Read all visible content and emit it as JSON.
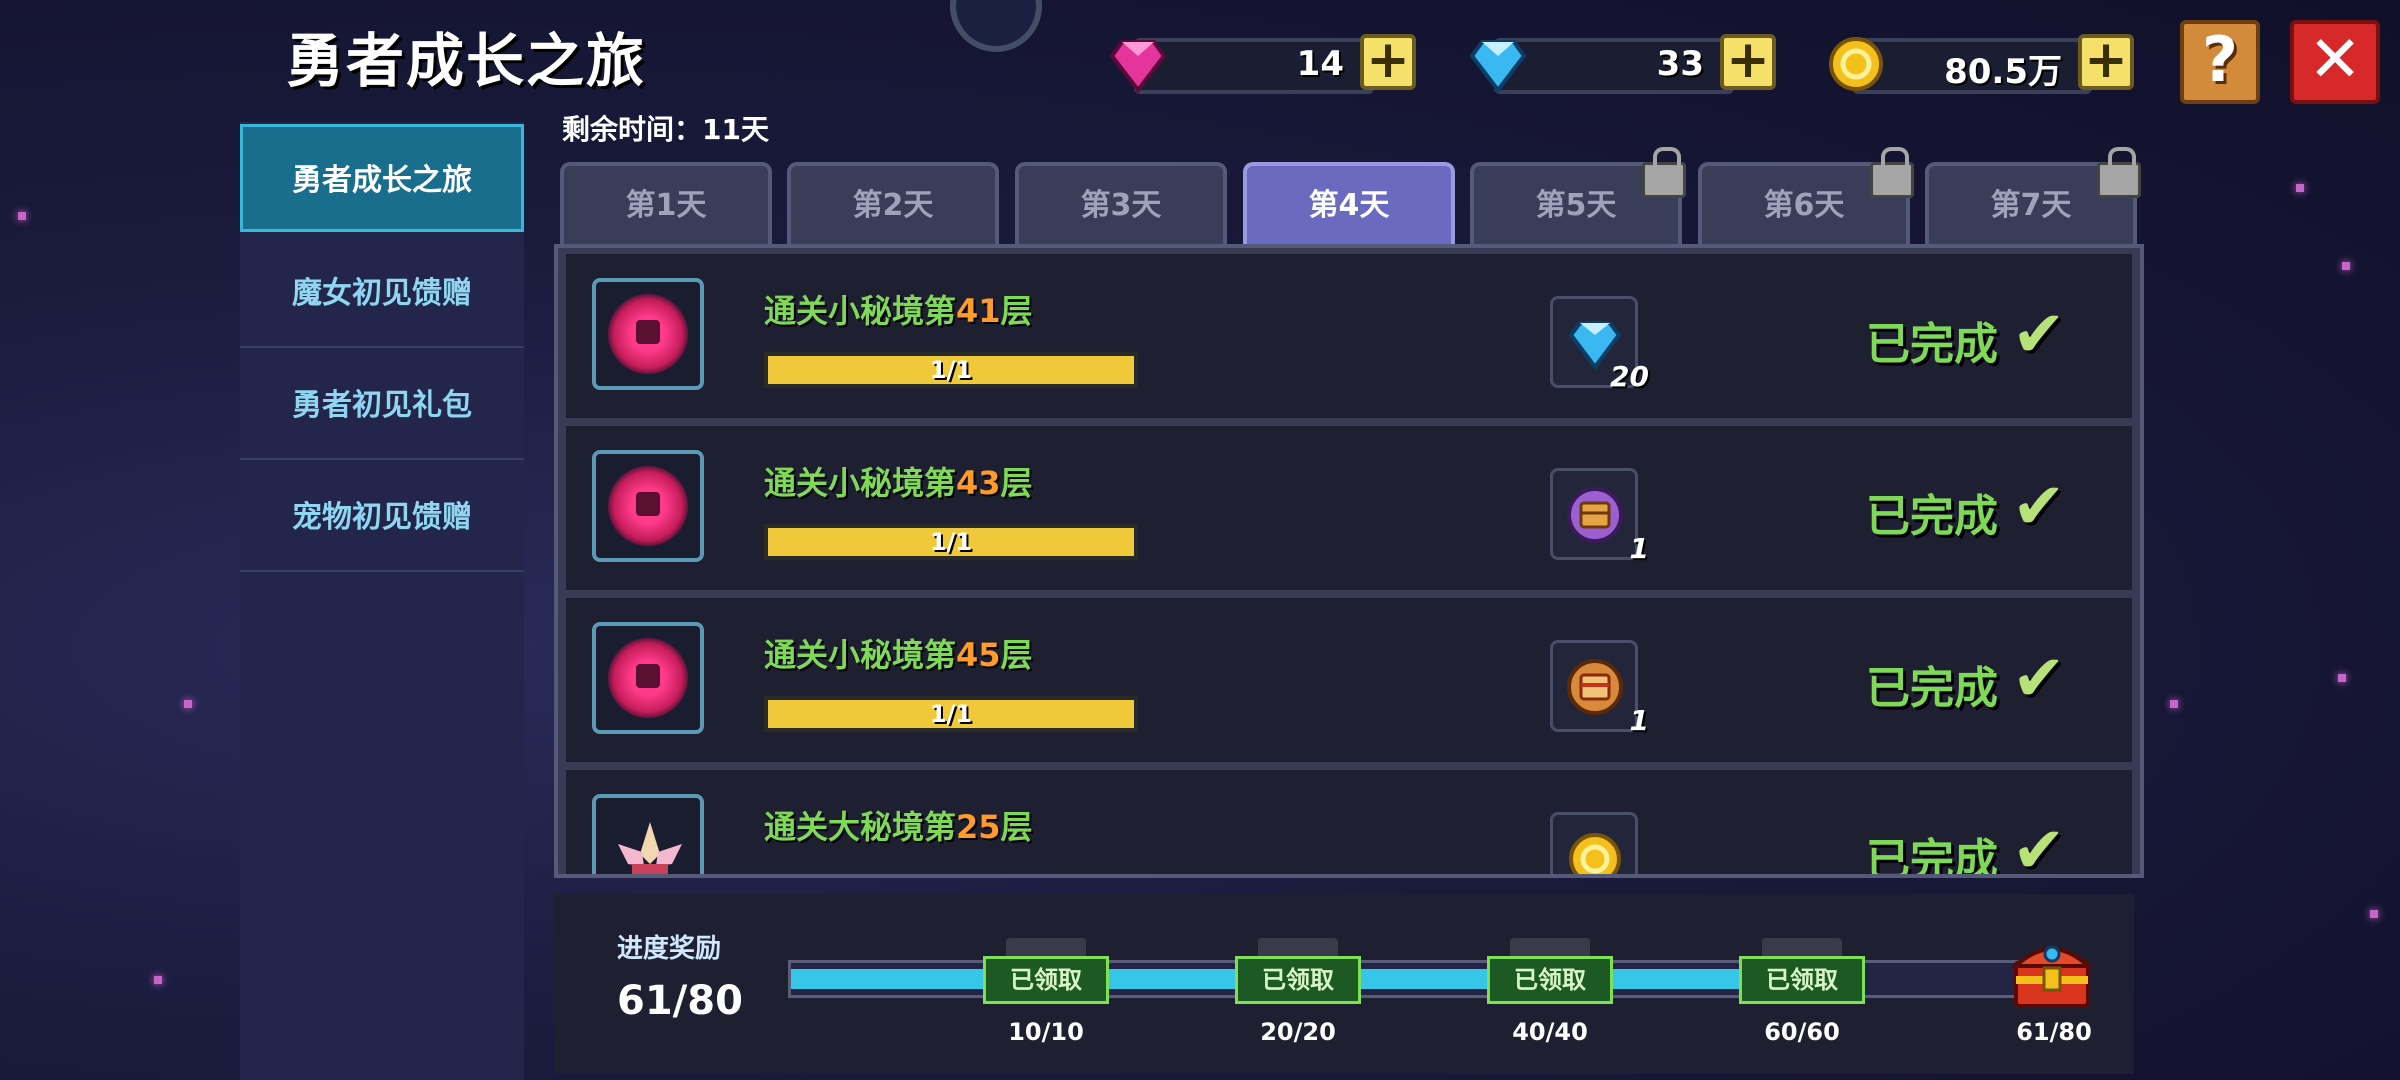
{
  "header": {
    "title": "勇者成长之旅"
  },
  "currencies": [
    {
      "icon": "pink-gem-icon",
      "value": "14",
      "color": "#e5359c"
    },
    {
      "icon": "blue-diamond-icon",
      "value": "33",
      "color": "#39b8f2"
    },
    {
      "icon": "gold-coin-icon",
      "value": "80.5万",
      "color": "#f4c01b"
    }
  ],
  "buttons": {
    "help": "?",
    "close": "✕",
    "plus": "+"
  },
  "sidebar": {
    "items": [
      {
        "label": "勇者成长之旅",
        "active": true
      },
      {
        "label": "魔女初见馈赠"
      },
      {
        "label": "勇者初见礼包"
      },
      {
        "label": "宠物初见馈赠"
      }
    ]
  },
  "remaining_time": "剩余时间：11天",
  "tabs": [
    {
      "label": "第1天"
    },
    {
      "label": "第2天"
    },
    {
      "label": "第3天"
    },
    {
      "label": "第4天",
      "active": true
    },
    {
      "label": "第5天",
      "locked": true
    },
    {
      "label": "第6天",
      "locked": true
    },
    {
      "label": "第7天",
      "locked": true
    }
  ],
  "tasks": [
    {
      "title_prefix": "通关小秘境第",
      "num": "41",
      "title_suffix": "层",
      "progress": "1/1",
      "reward_icon": "blue-diamond-icon",
      "reward_count": "20",
      "status": "已完成"
    },
    {
      "title_prefix": "通关小秘境第",
      "num": "43",
      "title_suffix": "层",
      "progress": "1/1",
      "reward_icon": "purple-chest-icon",
      "reward_count": "1",
      "status": "已完成"
    },
    {
      "title_prefix": "通关小秘境第",
      "num": "45",
      "title_suffix": "层",
      "progress": "1/1",
      "reward_icon": "orange-chest-icon",
      "reward_count": "1",
      "status": "已完成"
    },
    {
      "title_prefix": "通关大秘境第",
      "num": "25",
      "title_suffix": "层",
      "progress": "",
      "reward_icon": "gold-coin-icon",
      "reward_count": "",
      "status": "已完成"
    }
  ],
  "progress_reward": {
    "label": "进度奖励",
    "value": "61/80",
    "fraction": 0.7625,
    "milestones": [
      {
        "button": "已领取",
        "label": "10/10"
      },
      {
        "button": "已领取",
        "label": "20/20"
      },
      {
        "button": "已领取",
        "label": "40/40"
      },
      {
        "button": "已领取",
        "label": "60/60"
      }
    ],
    "final_label": "61/80"
  }
}
